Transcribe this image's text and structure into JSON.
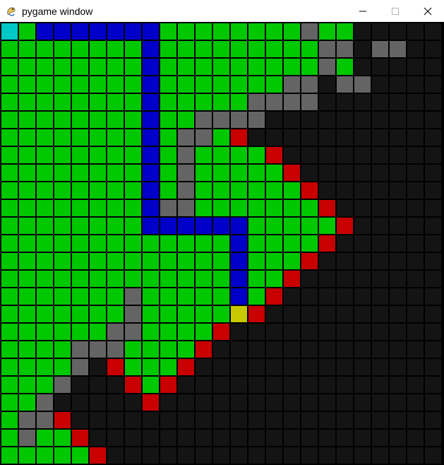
{
  "window": {
    "title": "pygame window",
    "app_icon": "pygame-snake-icon",
    "controls": {
      "minimize_icon": "minimize-icon",
      "maximize_icon": "maximize-icon",
      "close_icon": "close-icon"
    }
  },
  "grid": {
    "columns": 25,
    "rows": 25,
    "legend": {
      "c": {
        "meaning": "start",
        "color": "#00c8c8"
      },
      "y": {
        "meaning": "end",
        "color": "#c8c800"
      },
      "b": {
        "meaning": "path",
        "color": "#0000c8"
      },
      "g": {
        "meaning": "visited",
        "color": "#00c800"
      },
      "r": {
        "meaning": "frontier",
        "color": "#c80000"
      },
      "s": {
        "meaning": "barrier",
        "color": "#646464"
      },
      "k": {
        "meaning": "empty",
        "color": "#141414"
      }
    },
    "cells": [
      "cgbbbbbbbggggggggsggkkkkk",
      "ggggggggbgggggggggssksskk",
      "ggggggggbgggggggggsgkkkkk",
      "ggggggggbgggggggssksskkkk",
      "ggggggggbgggggsssskkkkkkk",
      "ggggggggbggsssskkkkkkkkkk",
      "ggggggggbgssgrkkkkkkkkkkk",
      "ggggggggbgsggggrkkkkkkkkk",
      "ggggggggbgsgggggrkkkkkkkk",
      "ggggggggbgsggggggrkkkkkkk",
      "ggggggggbssgggggggrkkkkkk",
      "ggggggggbbbbbbgggggrkkkkk",
      "gggggggggggggbggggrkkkkkk",
      "gggggggggggggbgggrkkkkkkk",
      "gggggggggggggbggrkkkkkkkk",
      "gggggggsgggggbgrkkkkkkkkk",
      "gggggggsgggggyrkkkkkkkkkk",
      "ggggggssggggrkkkkkkkkkkkk",
      "ggggsssggggrkkkkkkkkkkkkk",
      "ggggskrgggrkkkkkkkkkkkkkk",
      "gggskkkrgrkkkkkkkkkkkkkkk",
      "ggskkkkkrkkkkkkkkkkkkkkkk",
      "gssrkkkkkkkkkkkkkkkkkkkkk",
      "gsggrkkkkkkkkkkkkkkkkkkkk",
      "gggggrkkkkkkkkkkkkkkkkkkk"
    ]
  }
}
